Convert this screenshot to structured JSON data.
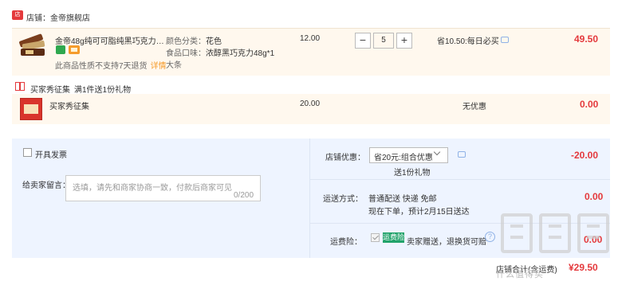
{
  "shop": {
    "icon_text": "店",
    "label": "店铺：金帝旗舰店"
  },
  "product": {
    "title": "金帝48g纯可可脂纯黑巧克力牛...",
    "note": "此商品性质不支持7天退货",
    "detail_link": "详情",
    "attr_color_label": "颜色分类：",
    "attr_color_value": "花色",
    "attr_flavor_label": "食品口味：",
    "attr_flavor_value": "浓醇黑巧克力48g*1",
    "attr_flavor_extra": "大条",
    "unit_price": "12.00",
    "quantity": "5",
    "minus": "−",
    "plus": "+",
    "savings": "省10.50:每日必买",
    "total": "49.50"
  },
  "gift": {
    "title": "买家秀征集",
    "rule": "满1件送1份礼物",
    "item_name": "买家秀征集",
    "price": "20.00",
    "discount": "无优惠",
    "total": "0.00"
  },
  "invoice": {
    "label": "开具发票"
  },
  "message": {
    "label": "给卖家留言：",
    "placeholder": "选填，请先和商家协商一致，付款后商家可见",
    "counter": "0/200"
  },
  "coupon": {
    "label": "店铺优惠：",
    "selected": "省20元:组合优惠",
    "gift_note": "送1份礼物",
    "amount": "-20.00"
  },
  "shipping": {
    "label": "运送方式：",
    "method": "普通配送 快递 免邮",
    "time": "现在下单，预计2月15日送达",
    "amount": "0.00"
  },
  "insurance": {
    "label": "运费险：",
    "tag": "运费险",
    "text": "卖家赠送，退换货可赔",
    "help": "?",
    "amount": "0.00"
  },
  "summary": {
    "label": "店铺合计(含运费)",
    "amount": "¥29.50"
  },
  "watermark": {
    "text": "什么值得买"
  },
  "colors": {
    "accent": "#e4393c",
    "panel": "#eef4ff",
    "item_bg": "#fff8ee"
  }
}
